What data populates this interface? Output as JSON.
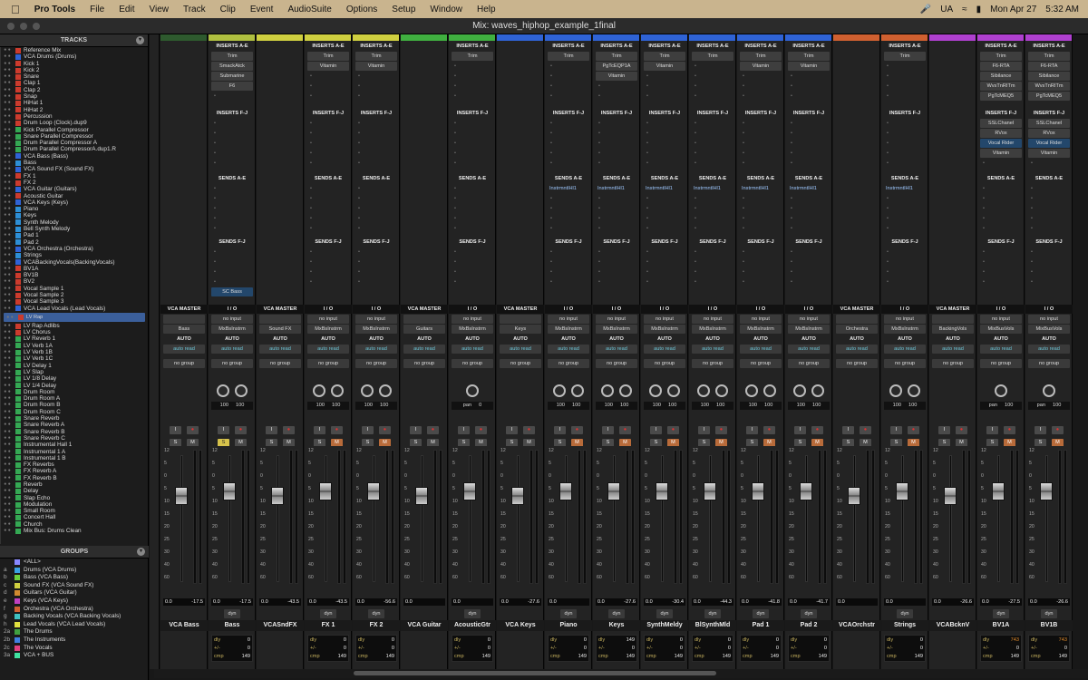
{
  "menubar": {
    "app_name": "Pro Tools",
    "items": [
      "File",
      "Edit",
      "View",
      "Track",
      "Clip",
      "Event",
      "AudioSuite",
      "Options",
      "Setup",
      "Window",
      "Help"
    ],
    "status_ua": "UA",
    "date": "Mon Apr 27",
    "time": "5:32 AM"
  },
  "window": {
    "title": "Mix: waves_hiphop_example_1final"
  },
  "tracks_panel": {
    "title": "TRACKS",
    "selected_index": 40,
    "tracks": [
      {
        "name": "Reference Mix",
        "type": "au"
      },
      {
        "name": "VCA Drums (Drums)",
        "type": "vca"
      },
      {
        "name": "Kick 1",
        "type": "au"
      },
      {
        "name": "Kick 2",
        "type": "au"
      },
      {
        "name": "Snare",
        "type": "au"
      },
      {
        "name": "Clap 1",
        "type": "au"
      },
      {
        "name": "Clap 2",
        "type": "au"
      },
      {
        "name": "Snap",
        "type": "au"
      },
      {
        "name": "HiHat 1",
        "type": "au"
      },
      {
        "name": "HiHat 2",
        "type": "au"
      },
      {
        "name": "Percussion",
        "type": "au"
      },
      {
        "name": "Drum Loop (Clock).dup9",
        "type": "au"
      },
      {
        "name": "Kick Parallel Compressor",
        "type": "aux"
      },
      {
        "name": "Snare Parallel Compressor",
        "type": "aux"
      },
      {
        "name": "Drum Parallel Compressor A",
        "type": "aux"
      },
      {
        "name": "Drum Parallel CompressorA.dup1.R",
        "type": "aux"
      },
      {
        "name": "VCA Bass (Bass)",
        "type": "vca"
      },
      {
        "name": "Bass",
        "type": "ins"
      },
      {
        "name": "VCA Sound FX (Sound FX)",
        "type": "vca"
      },
      {
        "name": "FX 1",
        "type": "au"
      },
      {
        "name": "FX 2",
        "type": "au"
      },
      {
        "name": "VCA Guitar (Guitars)",
        "type": "vca"
      },
      {
        "name": "Acoustic Guitar",
        "type": "au"
      },
      {
        "name": "VCA Keys (Keys)",
        "type": "vca"
      },
      {
        "name": "Piano",
        "type": "ins"
      },
      {
        "name": "Keys",
        "type": "ins"
      },
      {
        "name": "Synth Melody",
        "type": "ins"
      },
      {
        "name": "Bell Synth Melody",
        "type": "ins"
      },
      {
        "name": "Pad 1",
        "type": "ins"
      },
      {
        "name": "Pad 2",
        "type": "ins"
      },
      {
        "name": "VCA Orchestra (Orchestra)",
        "type": "vca"
      },
      {
        "name": "Strings",
        "type": "ins"
      },
      {
        "name": "VCABackingVocals(BackingVocals)",
        "type": "vca"
      },
      {
        "name": "BV1A",
        "type": "au"
      },
      {
        "name": "BV1B",
        "type": "au"
      },
      {
        "name": "BV2",
        "type": "au"
      },
      {
        "name": "Vocal Sample 1",
        "type": "au"
      },
      {
        "name": "Vocal Sample 2",
        "type": "au"
      },
      {
        "name": "Vocal Sample 3",
        "type": "au"
      },
      {
        "name": "VCA Lead Vocals (Lead Vocals)",
        "type": "vca"
      },
      {
        "name": "LV Rap",
        "type": "au"
      },
      {
        "name": "LV Rap Adlibs",
        "type": "au"
      },
      {
        "name": "LV Chorus",
        "type": "au"
      },
      {
        "name": "LV Reverb 1",
        "type": "aux"
      },
      {
        "name": "LV Verb 1A",
        "type": "aux"
      },
      {
        "name": "LV Verb 1B",
        "type": "aux"
      },
      {
        "name": "LV Verb 1C",
        "type": "aux"
      },
      {
        "name": "LV Delay 1",
        "type": "aux"
      },
      {
        "name": "LV Slap",
        "type": "aux"
      },
      {
        "name": "LV 1/8 Delay",
        "type": "aux"
      },
      {
        "name": "LV 1/4 Delay",
        "type": "aux"
      },
      {
        "name": "Drum Room",
        "type": "aux"
      },
      {
        "name": "Drum Room A",
        "type": "aux"
      },
      {
        "name": "Drum Room B",
        "type": "aux"
      },
      {
        "name": "Drum Room C",
        "type": "aux"
      },
      {
        "name": "Snare Reverb",
        "type": "aux"
      },
      {
        "name": "Snare Reverb A",
        "type": "aux"
      },
      {
        "name": "Snare Reverb B",
        "type": "aux"
      },
      {
        "name": "Snare Reverb C",
        "type": "aux"
      },
      {
        "name": "Instrumental Hall 1",
        "type": "aux"
      },
      {
        "name": "Instrumental 1 A",
        "type": "aux"
      },
      {
        "name": "Instrumental 1 B",
        "type": "aux"
      },
      {
        "name": "FX Reverbs",
        "type": "aux"
      },
      {
        "name": "FX Reverb A",
        "type": "aux"
      },
      {
        "name": "FX Reverb B",
        "type": "aux"
      },
      {
        "name": "Reverb",
        "type": "aux"
      },
      {
        "name": "Delay",
        "type": "aux"
      },
      {
        "name": "Slap Echo",
        "type": "aux"
      },
      {
        "name": "Modulation",
        "type": "aux"
      },
      {
        "name": "Small Room",
        "type": "aux"
      },
      {
        "name": "Concert Hall",
        "type": "aux"
      },
      {
        "name": "Church",
        "type": "aux"
      },
      {
        "name": "Mix Bus: Drums Clean",
        "type": "aux"
      }
    ]
  },
  "groups_panel": {
    "title": "GROUPS",
    "groups": [
      {
        "id": "",
        "name": "<ALL>",
        "color": "#8888ff"
      },
      {
        "id": "a",
        "name": "Drums (VCA Drums)",
        "color": "#3aa0e0"
      },
      {
        "id": "b",
        "name": "Bass (VCA Bass)",
        "color": "#6ccf3a"
      },
      {
        "id": "c",
        "name": "Sound FX (VCA Sound FX)",
        "color": "#d0d040"
      },
      {
        "id": "d",
        "name": "Guitars (VCA Guitar)",
        "color": "#d08a30"
      },
      {
        "id": "e",
        "name": "Keys (VCA Keys)",
        "color": "#c040c0"
      },
      {
        "id": "f",
        "name": "Orchestra (VCA Orchestra)",
        "color": "#d06030"
      },
      {
        "id": "g",
        "name": "Backing Vocals (VCA Backing Vocals)",
        "color": "#40c0c0"
      },
      {
        "id": "h",
        "name": "Lead Vocals (VCA Lead Vocals)",
        "color": "#e0e040"
      },
      {
        "id": "2a",
        "name": "The Drums",
        "color": "#40a040"
      },
      {
        "id": "2b",
        "name": "The Instruments",
        "color": "#4080e0"
      },
      {
        "id": "2c",
        "name": "The Vocals",
        "color": "#e04080"
      },
      {
        "id": "3a",
        "name": "VCA + BUS",
        "color": "#40e0a0"
      }
    ]
  },
  "labels": {
    "inserts_ae": "INSERTS A-E",
    "inserts_fj": "INSERTS F-J",
    "sends_ae": "SENDS A-E",
    "sends_fj": "SENDS F-J",
    "io": "I / O",
    "vca_master": "VCA MASTER",
    "auto": "AUTO",
    "auto_read": "auto read",
    "no_group": "no group",
    "dyn": "dyn",
    "dly": "dly",
    "plusminus": "+/-",
    "cmp": "cmp",
    "no_input": "no input",
    "btn_i": "I",
    "btn_s": "S",
    "btn_m": "M"
  },
  "strips": [
    {
      "name": "VCA Bass",
      "color": "#2e5a2e",
      "kind": "vca",
      "sel": "Bass",
      "ins1": [],
      "ins2": [],
      "s1": [],
      "s2": [],
      "vol": "0.0",
      "pk": "-17.5",
      "fader": 0.35,
      "knobs": 0,
      "dly": "",
      "pm": "",
      "cmp": ""
    },
    {
      "name": "Bass",
      "color": "#b0c040",
      "kind": "track",
      "inp": "no input",
      "out": "MxBsInstrm",
      "ins1": [
        "Trim",
        "SmackAtck",
        "Submarine",
        "F6"
      ],
      "ins2": [],
      "s1": [],
      "s2": [],
      "sendbox": "SC Bass",
      "pan": [
        "100",
        "100"
      ],
      "solo": true,
      "mute": false,
      "vol": "0.0",
      "pk": "-17.5",
      "fader": 0.3,
      "knobs": 2,
      "dly": "0",
      "pm": "0",
      "cmp": "149"
    },
    {
      "name": "VCASndFX",
      "color": "#d0d040",
      "kind": "vca",
      "sel": "Sound FX",
      "ins1": [],
      "ins2": [],
      "s1": [],
      "s2": [],
      "vol": "0.0",
      "pk": "-43.5",
      "fader": 0.35,
      "knobs": 0,
      "dly": "",
      "pm": "",
      "cmp": ""
    },
    {
      "name": "FX 1",
      "color": "#d0d040",
      "kind": "track",
      "inp": "no input",
      "out": "MxBsInstrm",
      "ins1": [
        "Trim",
        "Vitamin"
      ],
      "ins2": [],
      "s1": [],
      "s2": [],
      "pan": [
        "100",
        "100"
      ],
      "solo": false,
      "mute": true,
      "vol": "0.0",
      "pk": "-43.5",
      "fader": 0.3,
      "knobs": 2,
      "dly": "0",
      "pm": "0",
      "cmp": "149"
    },
    {
      "name": "FX 2",
      "color": "#d0d040",
      "kind": "track",
      "inp": "no input",
      "out": "MxBsInstrm",
      "ins1": [
        "Trim",
        "Vitamin"
      ],
      "ins2": [],
      "s1": [],
      "s2": [],
      "pan": [
        "100",
        "100"
      ],
      "solo": false,
      "mute": true,
      "vol": "0.0",
      "pk": "-56.6",
      "fader": 0.3,
      "knobs": 2,
      "dly": "0",
      "pm": "0",
      "cmp": "149"
    },
    {
      "name": "VCA Guitar",
      "color": "#40b040",
      "kind": "vca",
      "sel": "Guitars",
      "ins1": [],
      "ins2": [],
      "s1": [],
      "s2": [],
      "vol": "0.0",
      "pk": "",
      "fader": 0.35,
      "knobs": 0,
      "dly": "",
      "pm": "",
      "cmp": ""
    },
    {
      "name": "AcousticGtr",
      "color": "#40b040",
      "kind": "track",
      "inp": "no input",
      "out": "MxBsInstrm",
      "ins1": [
        "Trim"
      ],
      "ins2": [],
      "s1": [],
      "s2": [],
      "pan": [
        "pan",
        "0"
      ],
      "solo": false,
      "mute": false,
      "vol": "0.0",
      "pk": "",
      "fader": 0.3,
      "knobs": 1,
      "dly": "0",
      "pm": "0",
      "cmp": "149"
    },
    {
      "name": "VCA Keys",
      "color": "#2f63d6",
      "kind": "vca",
      "sel": "Keys",
      "ins1": [],
      "ins2": [],
      "s1": [],
      "s2": [],
      "vol": "0.0",
      "pk": "-27.6",
      "fader": 0.35,
      "knobs": 0,
      "dly": "",
      "pm": "",
      "cmp": ""
    },
    {
      "name": "Piano",
      "color": "#2f63d6",
      "kind": "track",
      "inp": "no input",
      "out": "MxBsInstrm",
      "ins1": [
        "Trim"
      ],
      "ins2": [],
      "s1": [
        "InstrmntlHl1"
      ],
      "s2": [],
      "pan": [
        "100",
        "100"
      ],
      "solo": false,
      "mute": true,
      "vol": "0.0",
      "pk": "",
      "fader": 0.3,
      "knobs": 2,
      "dly": "0",
      "pm": "0",
      "cmp": "149"
    },
    {
      "name": "Keys",
      "color": "#2f63d6",
      "kind": "track",
      "inp": "no input",
      "out": "MxBsInstrm",
      "ins1": [
        "Trim",
        "PgTcEQP1A",
        "Vitamin"
      ],
      "ins2": [],
      "s1": [
        "InstrmntlHl1"
      ],
      "s2": [],
      "pan": [
        "100",
        "100"
      ],
      "solo": false,
      "mute": true,
      "vol": "0.0",
      "pk": "-27.6",
      "fader": 0.3,
      "knobs": 2,
      "dly": "149",
      "pm": "0",
      "cmp": "149"
    },
    {
      "name": "SynthMeldy",
      "color": "#2f63d6",
      "kind": "track",
      "inp": "no input",
      "out": "MxBsInstrm",
      "ins1": [
        "Trim",
        "Vitamin"
      ],
      "ins2": [],
      "s1": [
        "InstrmntlHl1"
      ],
      "s2": [],
      "pan": [
        "100",
        "100"
      ],
      "solo": false,
      "mute": true,
      "vol": "0.0",
      "pk": "-30.4",
      "fader": 0.3,
      "knobs": 2,
      "dly": "0",
      "pm": "0",
      "cmp": "149"
    },
    {
      "name": "BlSynthMld",
      "color": "#2f63d6",
      "kind": "track",
      "inp": "no input",
      "out": "MxBsInstrm",
      "ins1": [
        "Trim"
      ],
      "ins2": [],
      "s1": [
        "InstrmntlHl1"
      ],
      "s2": [],
      "pan": [
        "100",
        "100"
      ],
      "solo": false,
      "mute": true,
      "vol": "0.0",
      "pk": "-44.3",
      "fader": 0.3,
      "knobs": 2,
      "dly": "0",
      "pm": "0",
      "cmp": "149"
    },
    {
      "name": "Pad 1",
      "color": "#2f63d6",
      "kind": "track",
      "inp": "no input",
      "out": "MxBsInstrm",
      "ins1": [
        "Trim",
        "Vitamin"
      ],
      "ins2": [],
      "s1": [
        "InstrmntlHl1"
      ],
      "s2": [],
      "pan": [
        "100",
        "100"
      ],
      "solo": false,
      "mute": true,
      "vol": "0.0",
      "pk": "-41.8",
      "fader": 0.3,
      "knobs": 2,
      "dly": "0",
      "pm": "0",
      "cmp": "149"
    },
    {
      "name": "Pad 2",
      "color": "#2f63d6",
      "kind": "track",
      "inp": "no input",
      "out": "MxBsInstrm",
      "ins1": [
        "Trim",
        "Vitamin"
      ],
      "ins2": [],
      "s1": [
        "InstrmntlHl1"
      ],
      "s2": [],
      "pan": [
        "100",
        "100"
      ],
      "solo": false,
      "mute": true,
      "vol": "0.0",
      "pk": "-41.7",
      "fader": 0.3,
      "knobs": 2,
      "dly": "0",
      "pm": "0",
      "cmp": "149"
    },
    {
      "name": "VCAOrchstr",
      "color": "#d06030",
      "kind": "vca",
      "sel": "Orchestra",
      "ins1": [],
      "ins2": [],
      "s1": [],
      "s2": [],
      "vol": "0.0",
      "pk": "",
      "fader": 0.35,
      "knobs": 0,
      "dly": "",
      "pm": "",
      "cmp": ""
    },
    {
      "name": "Strings",
      "color": "#d06030",
      "kind": "track",
      "inp": "no input",
      "out": "MxBsInstrm",
      "ins1": [
        "Trim"
      ],
      "ins2": [],
      "s1": [
        "InstrmntlHl1"
      ],
      "s2": [],
      "pan": [
        "100",
        "100"
      ],
      "solo": false,
      "mute": true,
      "vol": "0.0",
      "pk": "",
      "fader": 0.3,
      "knobs": 2,
      "dly": "0",
      "pm": "0",
      "cmp": "149"
    },
    {
      "name": "VCABcknV",
      "color": "#b040d0",
      "kind": "vca",
      "sel": "BackingVols",
      "ins1": [],
      "ins2": [],
      "s1": [],
      "s2": [],
      "vol": "0.0",
      "pk": "-26.6",
      "fader": 0.35,
      "knobs": 0,
      "dly": "",
      "pm": "",
      "cmp": ""
    },
    {
      "name": "BV1A",
      "color": "#b040d0",
      "kind": "track",
      "inp": "no input",
      "out": "MixBusVols",
      "ins1": [
        "Trim",
        "F6-RTA",
        "Sibilance",
        "WvsTnRITm",
        "PgTcMEQ5"
      ],
      "ins2": [
        "SSLChanel",
        "RVox",
        "Vocal Rider",
        "Vitamin"
      ],
      "s1": [],
      "s2": [],
      "pan": [
        "pan",
        "100"
      ],
      "solo": false,
      "mute": true,
      "vol": "0.0",
      "pk": "-27.5",
      "fader": 0.3,
      "knobs": 1,
      "dly": "743",
      "pm": "0",
      "cmp": "149",
      "orange": true
    },
    {
      "name": "BV1B",
      "color": "#b040d0",
      "kind": "track",
      "inp": "no input",
      "out": "MixBusVols",
      "ins1": [
        "Trim",
        "F6-RTA",
        "Sibilance",
        "WvsTnRITm",
        "PgTcMEQ5"
      ],
      "ins2": [
        "SSLChanel",
        "RVox",
        "Vocal Rider",
        "Vitamin"
      ],
      "s1": [],
      "s2": [],
      "pan": [
        "pan",
        "100"
      ],
      "solo": false,
      "mute": true,
      "vol": "0.0",
      "pk": "-26.6",
      "fader": 0.3,
      "knobs": 1,
      "dly": "743",
      "pm": "0",
      "cmp": "149",
      "orange": true
    }
  ]
}
